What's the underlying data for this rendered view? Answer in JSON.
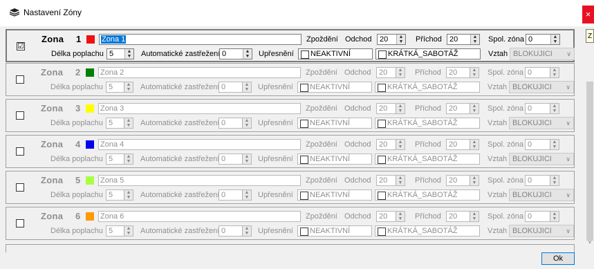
{
  "window": {
    "title": "Nastavení Zóny",
    "close_glyph": "×",
    "icon": "layers-icon"
  },
  "tooltip_stub": "Z",
  "labels": {
    "zone": "Zona",
    "delay": "Zpoždění",
    "departure": "Odchod",
    "arrival": "Příchod",
    "shared_zone": "Spol. zóna",
    "alarm_length": "Délka poplachu",
    "auto_arm": "Automatické zastřežení",
    "refinement": "Upřesnění",
    "relation": "Vztah"
  },
  "zones": [
    {
      "enabled": true,
      "checked_glyph": "☑",
      "number": "1",
      "color": "#ee1111",
      "name": "Zona 1",
      "departure": "20",
      "arrival": "20",
      "shared": "0",
      "alarm_length": "5",
      "auto_arm": "0",
      "inactive": "NEAKTIVNÍ",
      "short": "KRÁTKÁ_SABOTÁŽ",
      "relation": "BLOKUJICI"
    },
    {
      "enabled": false,
      "checked_glyph": "",
      "number": "2",
      "color": "#008000",
      "name": "Zona 2",
      "departure": "20",
      "arrival": "20",
      "shared": "0",
      "alarm_length": "5",
      "auto_arm": "0",
      "inactive": "NEAKTIVNÍ",
      "short": "KRÁTKÁ_SABOTÁŽ",
      "relation": "BLOKUJICI"
    },
    {
      "enabled": false,
      "checked_glyph": "",
      "number": "3",
      "color": "#ffff00",
      "name": "Zona 3",
      "departure": "20",
      "arrival": "20",
      "shared": "0",
      "alarm_length": "5",
      "auto_arm": "0",
      "inactive": "NEAKTIVNÍ",
      "short": "KRÁTKÁ_SABOTÁŽ",
      "relation": "BLOKUJICI"
    },
    {
      "enabled": false,
      "checked_glyph": "",
      "number": "4",
      "color": "#0000ee",
      "name": "Zona 4",
      "departure": "20",
      "arrival": "20",
      "shared": "0",
      "alarm_length": "5",
      "auto_arm": "0",
      "inactive": "NEAKTIVNÍ",
      "short": "KRÁTKÁ_SABOTÁŽ",
      "relation": "BLOKUJICI"
    },
    {
      "enabled": false,
      "checked_glyph": "",
      "number": "5",
      "color": "#aaff44",
      "name": "Zona 5",
      "departure": "20",
      "arrival": "20",
      "shared": "0",
      "alarm_length": "5",
      "auto_arm": "0",
      "inactive": "NEAKTIVNÍ",
      "short": "KRÁTKÁ_SABOTÁŽ",
      "relation": "BLOKUJICI"
    },
    {
      "enabled": false,
      "checked_glyph": "",
      "number": "6",
      "color": "#ff9900",
      "name": "Zona 6",
      "departure": "20",
      "arrival": "20",
      "shared": "0",
      "alarm_length": "5",
      "auto_arm": "0",
      "inactive": "NEAKTIVNÍ",
      "short": "KRÁTKÁ_SABOTÁŽ",
      "relation": "BLOKUJICI"
    }
  ],
  "ok_label": "Ok"
}
